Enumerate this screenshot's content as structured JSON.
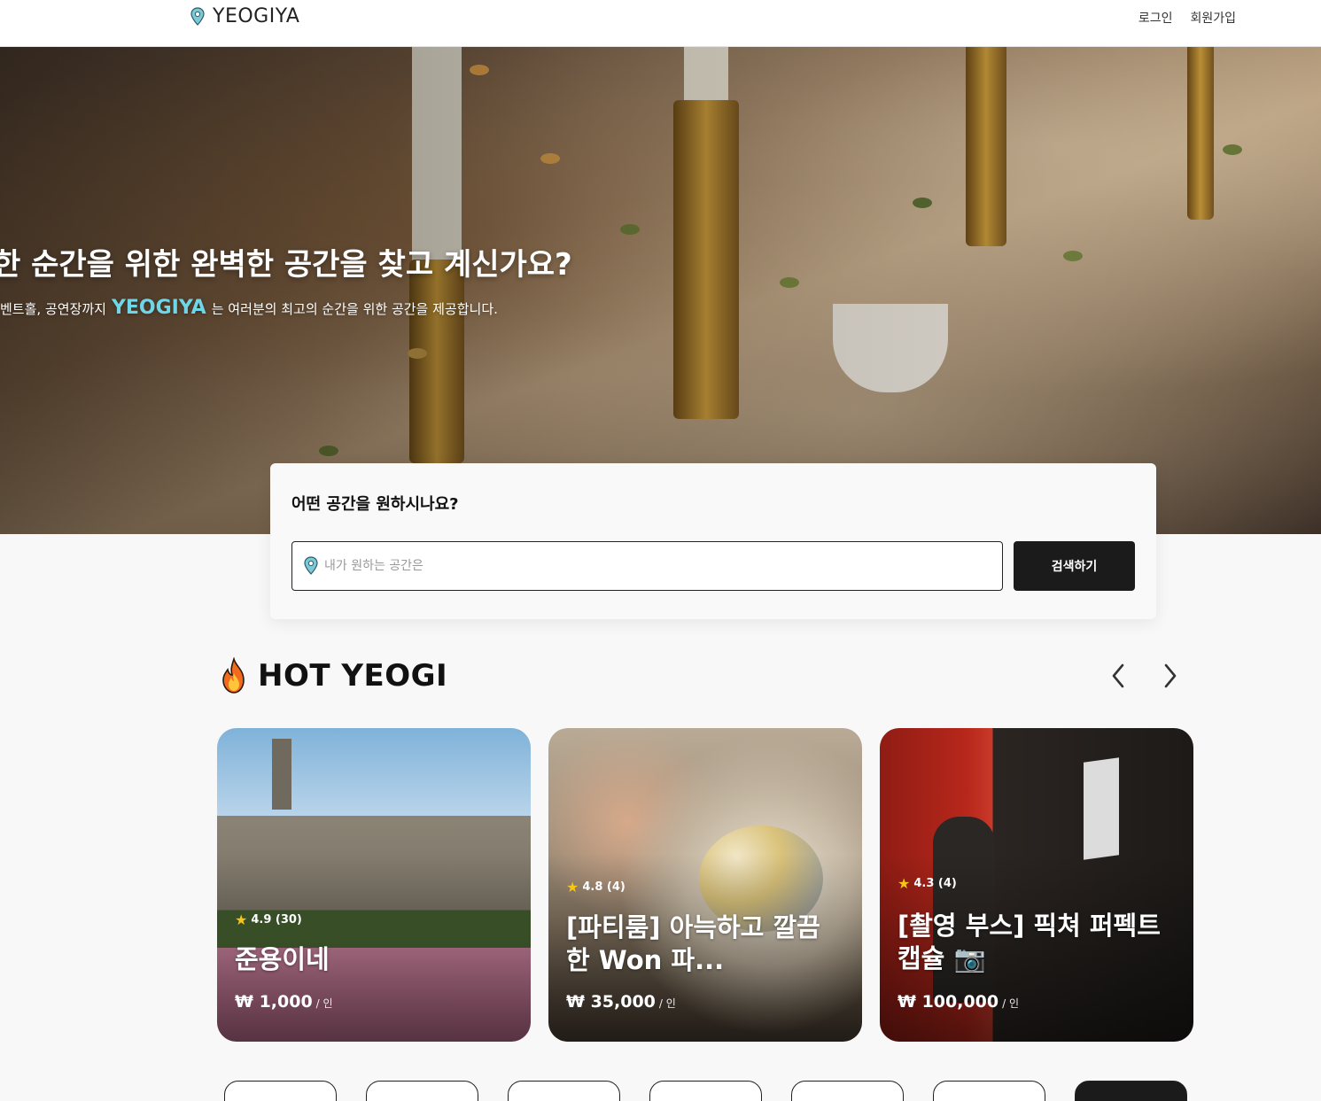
{
  "header": {
    "logo_text": "YEOGIYA",
    "login_label": "로그인",
    "signup_label": "회원가입"
  },
  "hero": {
    "title": "한 순간을 위한 완벽한 공간을 찾고 계신가요?",
    "subtitle_prefix": "벤트홀, 공연장까지",
    "subtitle_brand": "YEOGIYA",
    "subtitle_suffix": "는 여러분의 최고의 순간을 위한 공간을 제공합니다."
  },
  "search": {
    "question": "어떤 공간을 원하시나요?",
    "placeholder": "내가 원하는 공간은",
    "button_label": "검색하기"
  },
  "hot": {
    "section_title": "HOT YEOGI",
    "icon": "fire-icon",
    "cards": [
      {
        "rating": "4.9 (30)",
        "title": "준용이네",
        "price": "₩ 1,000",
        "unit": "/ 인"
      },
      {
        "rating": "4.8 (4)",
        "title": "[파티룸] 아늑하고 깔끔한 Won 파...",
        "price": "₩ 35,000",
        "unit": "/ 인"
      },
      {
        "rating": "4.3 (4)",
        "title": "[촬영 부스] 픽쳐 퍼펙트 캡슐 📷",
        "price": "₩ 100,000",
        "unit": "/ 인"
      }
    ]
  },
  "colors": {
    "brand_accent": "#6fd6e8",
    "dark_button": "#1b1b1b",
    "star": "#f5c518"
  }
}
